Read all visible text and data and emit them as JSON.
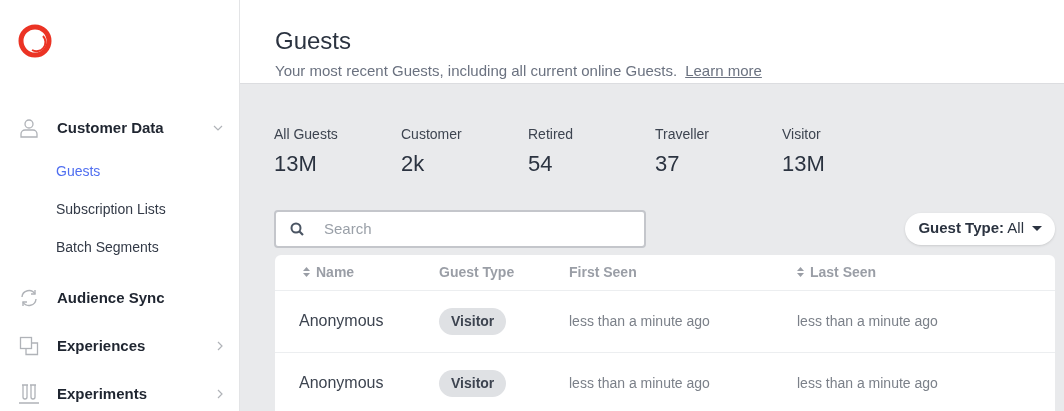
{
  "sidebar": {
    "items": [
      {
        "kind": "group",
        "label": "Customer Data",
        "expanded": true,
        "children": [
          {
            "label": "Guests",
            "selected": true
          },
          {
            "label": "Subscription Lists",
            "selected": false
          },
          {
            "label": "Batch Segments",
            "selected": false
          }
        ]
      },
      {
        "kind": "link",
        "label": "Audience Sync"
      },
      {
        "kind": "group",
        "label": "Experiences",
        "expanded": false
      },
      {
        "kind": "group",
        "label": "Experiments",
        "expanded": false
      }
    ]
  },
  "header": {
    "title": "Guests",
    "subtitle": "Your most recent Guests, including all current online Guests.",
    "link": "Learn more"
  },
  "stats": [
    {
      "label": "All Guests",
      "value": "13M"
    },
    {
      "label": "Customer",
      "value": "2k"
    },
    {
      "label": "Retired",
      "value": "54"
    },
    {
      "label": "Traveller",
      "value": "37"
    },
    {
      "label": "Visitor",
      "value": "13M"
    }
  ],
  "search": {
    "placeholder": "Search"
  },
  "filter": {
    "label": "**Guest Type:** All"
  },
  "table": {
    "columns": [
      {
        "label": "Name",
        "sortable": true
      },
      {
        "label": "Guest Type",
        "sortable": false
      },
      {
        "label": "First Seen",
        "sortable": false
      },
      {
        "label": "Last Seen",
        "sortable": true
      }
    ],
    "rows": [
      {
        "name": "Anonymous",
        "guest_type": "Visitor",
        "first_seen": "less than a minute ago",
        "last_seen": "less than a minute ago"
      },
      {
        "name": "Anonymous",
        "guest_type": "Visitor",
        "first_seen": "less than a minute ago",
        "last_seen": "less than a minute ago"
      }
    ]
  }
}
